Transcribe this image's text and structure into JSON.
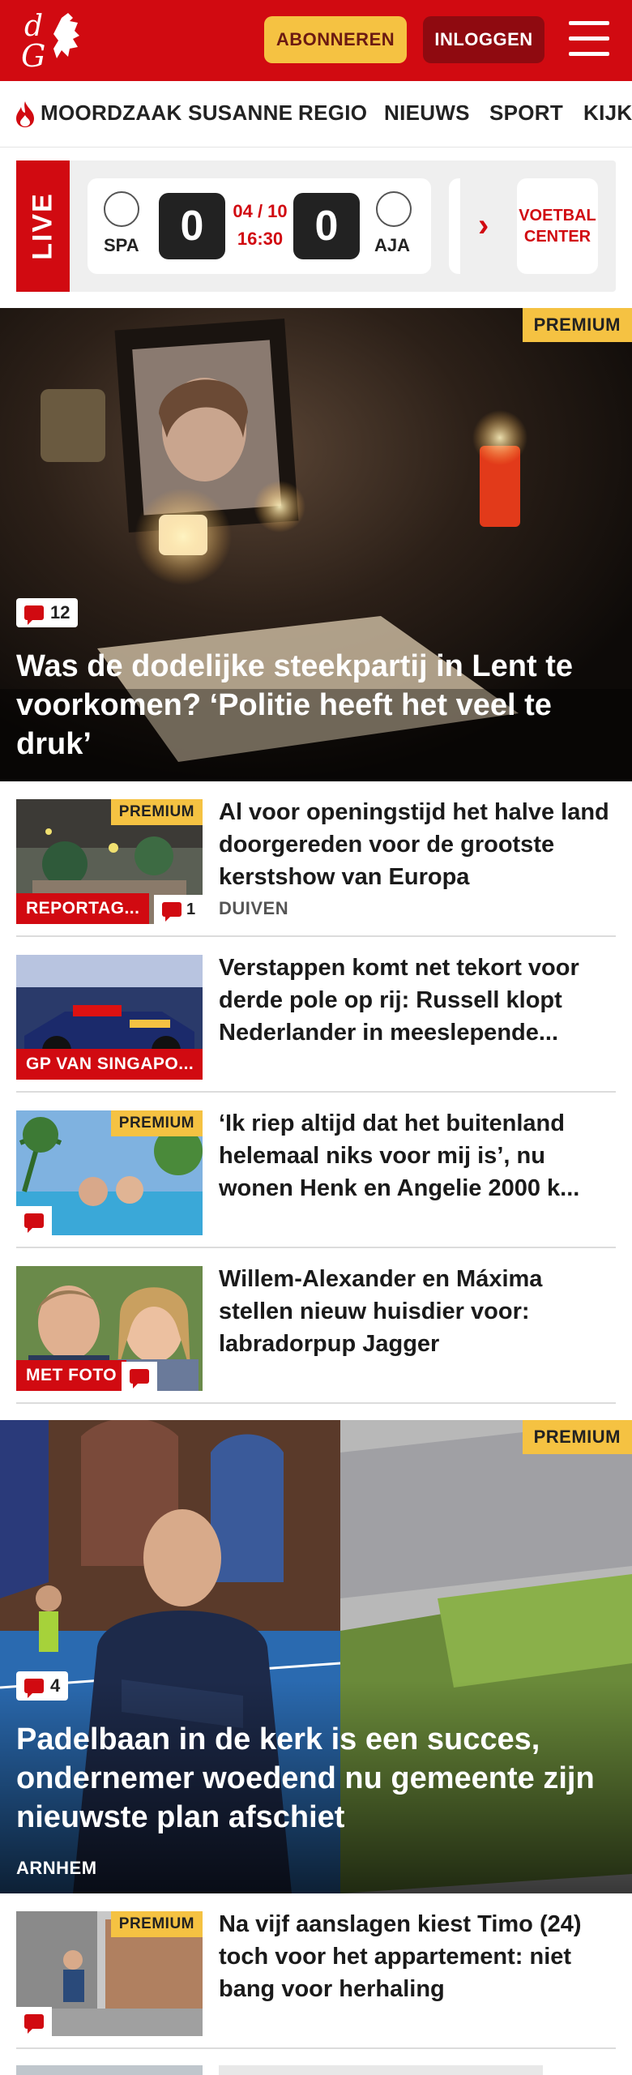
{
  "header": {
    "logo_text": "dG",
    "subscribe_label": "ABONNEREN",
    "login_label": "INLOGGEN",
    "brand_color": "#d10a11",
    "accent_color": "#f5c242"
  },
  "nav": {
    "items": [
      {
        "label": "MOORDZAAK SUSANNE",
        "icon": "flame-icon"
      },
      {
        "label": "REGIO"
      },
      {
        "label": "NIEUWS"
      },
      {
        "label": "SPORT"
      },
      {
        "label": "KIJK"
      }
    ]
  },
  "live": {
    "tag": "LIVE",
    "match": {
      "home": "SPA",
      "away": "AJA",
      "home_score": "0",
      "away_score": "0",
      "date": "04 / 10",
      "time": "16:30"
    },
    "center_label": "VOETBAL CENTER"
  },
  "hero1": {
    "premium": "PREMIUM",
    "comments": "12",
    "title": "Was de dodelijke steekpartij in Lent te voorkomen? ‘Politie heeft het veel te druk’"
  },
  "articles1": [
    {
      "title": "Al voor openingstijd het halve land doorgereden voor de grootste kerstshow van Europa",
      "location": "DUIVEN",
      "premium": "PREMIUM",
      "label": "REPORTAG...",
      "comments": "1"
    },
    {
      "title": "Verstappen komt net tekort voor derde pole op rij: Russell klopt Nederlander in meeslepende...",
      "label": "GP VAN SINGAPO..."
    },
    {
      "title": "‘Ik riep altijd dat het buitenland helemaal niks voor mij is’, nu wonen Henk en Angelie 2000 k...",
      "premium": "PREMIUM"
    },
    {
      "title": "Willem-Alexander en Máxima stellen nieuw huisdier voor: labradorpup Jagger",
      "label": "MET FOTO"
    }
  ],
  "hero2": {
    "premium": "PREMIUM",
    "comments": "4",
    "title": "Padelbaan in de kerk is een succes, ondernemer woedend nu gemeente zijn nieuwste plan afschiet",
    "location": "ARNHEM"
  },
  "articles2": [
    {
      "title": "Na vijf aanslagen kiest Timo (24) toch voor het appartement: niet bang voor herhaling",
      "premium": "PREMIUM"
    }
  ]
}
